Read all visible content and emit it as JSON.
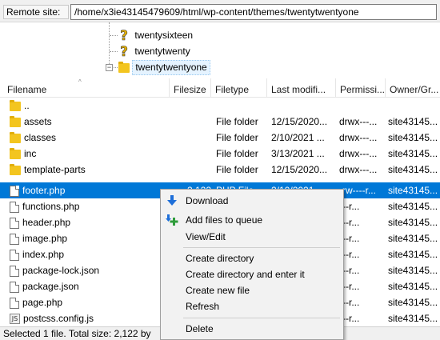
{
  "remote": {
    "label": "Remote site:",
    "path": "/home/x3ie43145479609/html/wp-content/themes/twentytwentyone"
  },
  "tree": [
    {
      "label": "twentysixteen",
      "icon": "question-icon"
    },
    {
      "label": "twentytwenty",
      "icon": "question-icon"
    },
    {
      "label": "twentytwentyone",
      "icon": "folder-icon",
      "selected": true,
      "expander": "−"
    }
  ],
  "columns": [
    "Filename",
    "Filesize",
    "Filetype",
    "Last modifi...",
    "Permissi...",
    "Owner/Gr..."
  ],
  "rows": [
    {
      "name": "..",
      "icon": "folder-icon",
      "size": "",
      "type": "",
      "modified": "",
      "perms": "",
      "owner": ""
    },
    {
      "name": "assets",
      "icon": "folder-icon",
      "size": "",
      "type": "File folder",
      "modified": "12/15/2020...",
      "perms": "drwx---...",
      "owner": "site43145..."
    },
    {
      "name": "classes",
      "icon": "folder-icon",
      "size": "",
      "type": "File folder",
      "modified": "2/10/2021 ...",
      "perms": "drwx---...",
      "owner": "site43145..."
    },
    {
      "name": "inc",
      "icon": "folder-icon",
      "size": "",
      "type": "File folder",
      "modified": "3/13/2021 ...",
      "perms": "drwx---...",
      "owner": "site43145..."
    },
    {
      "name": "template-parts",
      "icon": "folder-icon",
      "size": "",
      "type": "File folder",
      "modified": "12/15/2020...",
      "perms": "drwx---...",
      "owner": "site43145..."
    },
    {
      "name": "footer.php",
      "icon": "file-icon",
      "size": "2,122",
      "type": "PHP File",
      "modified": "2/10/2021 ...",
      "perms": "-rw----r...",
      "owner": "site43145...",
      "selected": true
    },
    {
      "name": "functions.php",
      "icon": "file-icon",
      "size": "",
      "type": "",
      "modified": "",
      "perms": "---r...",
      "owner": "site43145..."
    },
    {
      "name": "header.php",
      "icon": "file-icon",
      "size": "",
      "type": "",
      "modified": "",
      "perms": "---r...",
      "owner": "site43145..."
    },
    {
      "name": "image.php",
      "icon": "file-icon",
      "size": "",
      "type": "",
      "modified": "",
      "perms": "---r...",
      "owner": "site43145..."
    },
    {
      "name": "index.php",
      "icon": "file-icon",
      "size": "",
      "type": "",
      "modified": "",
      "perms": "---r...",
      "owner": "site43145..."
    },
    {
      "name": "package-lock.json",
      "icon": "file-icon",
      "size": "",
      "type": "",
      "modified": "",
      "perms": "---r...",
      "owner": "site43145..."
    },
    {
      "name": "package.json",
      "icon": "file-icon",
      "size": "",
      "type": "",
      "modified": "",
      "perms": "---r...",
      "owner": "site43145..."
    },
    {
      "name": "page.php",
      "icon": "file-icon",
      "size": "",
      "type": "",
      "modified": "",
      "perms": "---r...",
      "owner": "site43145..."
    },
    {
      "name": "postcss.config.js",
      "icon": "js-file-icon",
      "size": "",
      "type": "",
      "modified": "",
      "perms": "---r...",
      "owner": "site43145..."
    }
  ],
  "context_menu": {
    "download": "Download",
    "add_to_queue": "Add files to queue",
    "view_edit": "View/Edit",
    "create_directory": "Create directory",
    "create_directory_enter": "Create directory and enter it",
    "create_file": "Create new file",
    "refresh": "Refresh",
    "delete": "Delete"
  },
  "status": "Selected 1 file. Total size: 2,122 by",
  "colors": {
    "selection": "#0078d7",
    "folder": "#f3c51f",
    "download_arrow": "#1e6fd9",
    "queue_plus": "#2e9c3a"
  }
}
